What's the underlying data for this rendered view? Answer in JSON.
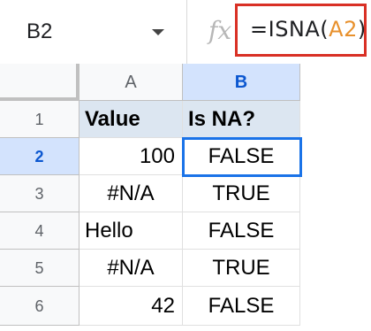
{
  "name_box": {
    "value": "B2"
  },
  "formula_bar": {
    "fx_label": "fx",
    "prefix": "=ISNA(",
    "ref": "A2",
    "suffix": ")"
  },
  "columns": [
    "A",
    "B"
  ],
  "rows": [
    {
      "num": "1",
      "a": "Value",
      "b": "Is NA?"
    },
    {
      "num": "2",
      "a": "100",
      "b": "FALSE"
    },
    {
      "num": "3",
      "a": "#N/A",
      "b": "TRUE"
    },
    {
      "num": "4",
      "a": "Hello",
      "b": "FALSE"
    },
    {
      "num": "5",
      "a": "#N/A",
      "b": "TRUE"
    },
    {
      "num": "6",
      "a": "42",
      "b": "FALSE"
    }
  ],
  "colors": {
    "formula_highlight": "#d93025",
    "selection": "#1a73e8",
    "header_fill": "#dce6f1",
    "reference": "#e8912d"
  }
}
